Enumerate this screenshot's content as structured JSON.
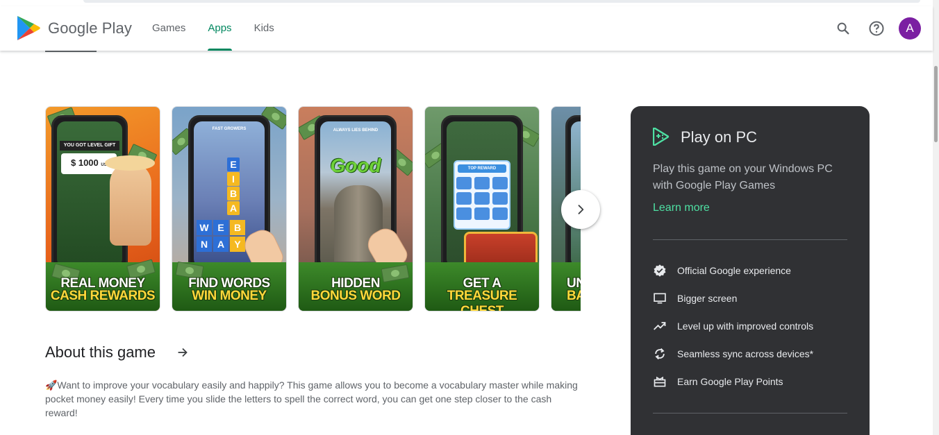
{
  "header": {
    "logo_text": "Google Play",
    "tabs": [
      {
        "label": "Games",
        "active": false
      },
      {
        "label": "Apps",
        "active": true
      },
      {
        "label": "Kids",
        "active": false
      }
    ],
    "search_icon": "search-icon",
    "help_icon": "help-icon",
    "avatar_letter": "A",
    "avatar_color": "#7b1fa2",
    "accent_color": "#01875f"
  },
  "screenshots": [
    {
      "caption_line1": "REAL MONEY",
      "caption_line2": "CASH REWARDS",
      "screen_text": "YOU GOT LEVEL GIFT",
      "screen_amount": "$ 1000",
      "screen_unit": "USD"
    },
    {
      "caption_line1": "FIND WORDS",
      "caption_line2": "WIN MONEY",
      "screen_text": "FAST GROWERS",
      "letters_vertical": [
        "E",
        "I",
        "B",
        "A",
        "B"
      ],
      "letters_row1": [
        "W",
        "E",
        "B"
      ],
      "letters_row2": [
        "N",
        "A",
        "Y"
      ]
    },
    {
      "caption_line1": "HIDDEN",
      "caption_line2": "BONUS WORD",
      "screen_text": "ALWAYS LIES BEHIND",
      "screen_word": "Good"
    },
    {
      "caption_line1": "GET A",
      "caption_line2": "TREASURE CHEST",
      "screen_text": "TOP REWARD"
    },
    {
      "caption_line1": "UN",
      "caption_line2": "BA"
    }
  ],
  "carousel": {
    "next_icon": "chevron-right-icon"
  },
  "about": {
    "title": "About this game",
    "arrow_icon": "arrow-right-icon",
    "description": "🚀Want to improve your vocabulary easily and happily? This game allows you to become a vocabulary master while making pocket money easily! Every time you slide the letters to spell the correct word, you can get one step closer to the cash reward!"
  },
  "play_on_pc": {
    "title": "Play on PC",
    "description": "Play this game on your Windows PC with Google Play Games",
    "learn_more": "Learn more",
    "features": [
      {
        "icon": "verified-badge-icon",
        "label": "Official Google experience"
      },
      {
        "icon": "monitor-icon",
        "label": "Bigger screen"
      },
      {
        "icon": "trending-up-icon",
        "label": "Level up with improved controls"
      },
      {
        "icon": "sync-icon",
        "label": "Seamless sync across devices*"
      },
      {
        "icon": "gift-icon",
        "label": "Earn Google Play Points"
      }
    ],
    "card_color": "#303134",
    "link_color": "#4ee0a3"
  }
}
